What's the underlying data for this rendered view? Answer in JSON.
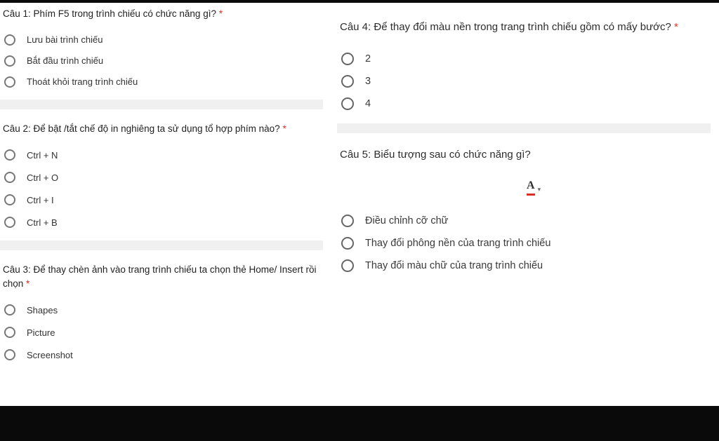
{
  "left": {
    "q1": {
      "title": "Câu 1: Phím F5 trong trình chiếu có chức năng gì?",
      "required": "*",
      "options": [
        "Lưu bài trình chiếu",
        "Bắt đầu trình chiếu",
        "Thoát khỏi trang trình chiếu"
      ]
    },
    "q2": {
      "title": "Câu 2: Để bật /tắt chế độ in nghiêng ta sử dụng tổ hợp phím nào?",
      "required": "*",
      "options": [
        "Ctrl + N",
        "Ctrl + O",
        "Ctrl + I",
        "Ctrl + B"
      ]
    },
    "q3": {
      "title": "Câu 3: Để thay chèn ảnh vào trang trình chiếu ta chọn thẻ Home/ Insert rồi chọn",
      "required": "*",
      "options": [
        "Shapes",
        "Picture",
        "Screenshot"
      ]
    }
  },
  "right": {
    "q4": {
      "title": "Câu 4: Để thay đổi màu nền trong trang trình chiếu gồm có mấy bước?",
      "required": "*",
      "options": [
        "2",
        "3",
        "4"
      ]
    },
    "q5": {
      "title": "Câu 5: Biểu tượng sau có chức năng gì?",
      "icon": "text-color-icon",
      "options": [
        "Điều chỉnh cỡ chữ",
        "Thay đổi phông nền của trang trình chiếu",
        "Thay đổi màu chữ của trang trình chiếu"
      ]
    }
  }
}
